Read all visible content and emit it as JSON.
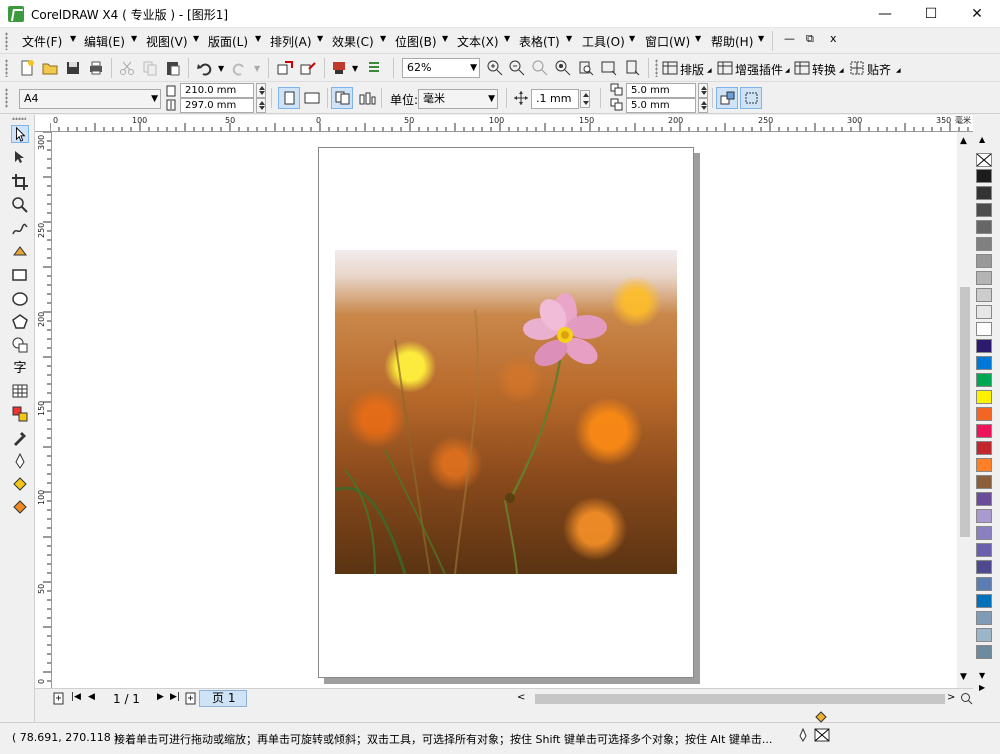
{
  "title": "CorelDRAW X4 ( 专业版 ) - [图形1]",
  "window_controls": {
    "minimize": "—",
    "maximize": "☐",
    "close": "✕"
  },
  "menu": [
    {
      "label": "文件(F)"
    },
    {
      "label": "编辑(E)"
    },
    {
      "label": "视图(V)"
    },
    {
      "label": "版面(L)"
    },
    {
      "label": "排列(A)"
    },
    {
      "label": "效果(C)"
    },
    {
      "label": "位图(B)"
    },
    {
      "label": "文本(X)"
    },
    {
      "label": "表格(T)"
    },
    {
      "label": "工具(O)"
    },
    {
      "label": "窗口(W)"
    },
    {
      "label": "帮助(H)"
    }
  ],
  "mdi_controls": {
    "minimize": "—",
    "restore": "⧉",
    "close": "x"
  },
  "standard_toolbar": {
    "zoom_value": "62%",
    "layout_label": "排版",
    "plugins_label": "增强插件",
    "convert_label": "转换",
    "snap_label": "贴齐"
  },
  "property_bar": {
    "paper_size": "A4",
    "width": "210.0 mm",
    "height": "297.0 mm",
    "units_label": "单位:",
    "units_value": "毫米",
    "nudge": ".1 mm",
    "dup_x": "5.0 mm",
    "dup_y": "5.0 mm"
  },
  "rulers": {
    "unit": "毫米",
    "horizontal_labels": [
      "0",
      "100",
      "50",
      "0",
      "50",
      "100",
      "150",
      "200",
      "250",
      "300",
      "350"
    ],
    "vertical_labels": [
      "300",
      "250",
      "200",
      "150",
      "100",
      "50",
      "0"
    ]
  },
  "page_nav": {
    "counter": "1 / 1",
    "page_tab": "页 1"
  },
  "status": {
    "coordinates": "( 78.691, 270.118 )",
    "hint": "接着单击可进行拖动或缩放；再单击可旋转或倾斜；双击工具，可选择所有对象；按住 Shift 键单击可选择多个对象；按住 Alt 键单击..."
  },
  "photo": {
    "description_icon": "flower-photo"
  },
  "colors": {
    "palette": [
      "#1c1c1c",
      "#333333",
      "#4d4d4d",
      "#666666",
      "#808080",
      "#999999",
      "#b3b3b3",
      "#cccccc",
      "#e6e6e6",
      "#ffffff",
      "#2b1a6e",
      "#0078d7",
      "#00a651",
      "#fff200",
      "#f26522",
      "#ed145b",
      "#c1272d",
      "#ff7f27",
      "#8b5e3c",
      "#6b4c9a",
      "#a99bd0",
      "#8a7fbf",
      "#6a5faf",
      "#4f4a90",
      "#5b7db1",
      "#0072bc",
      "#7f9bb5",
      "#9cb6c9",
      "#6c8a9e"
    ]
  }
}
